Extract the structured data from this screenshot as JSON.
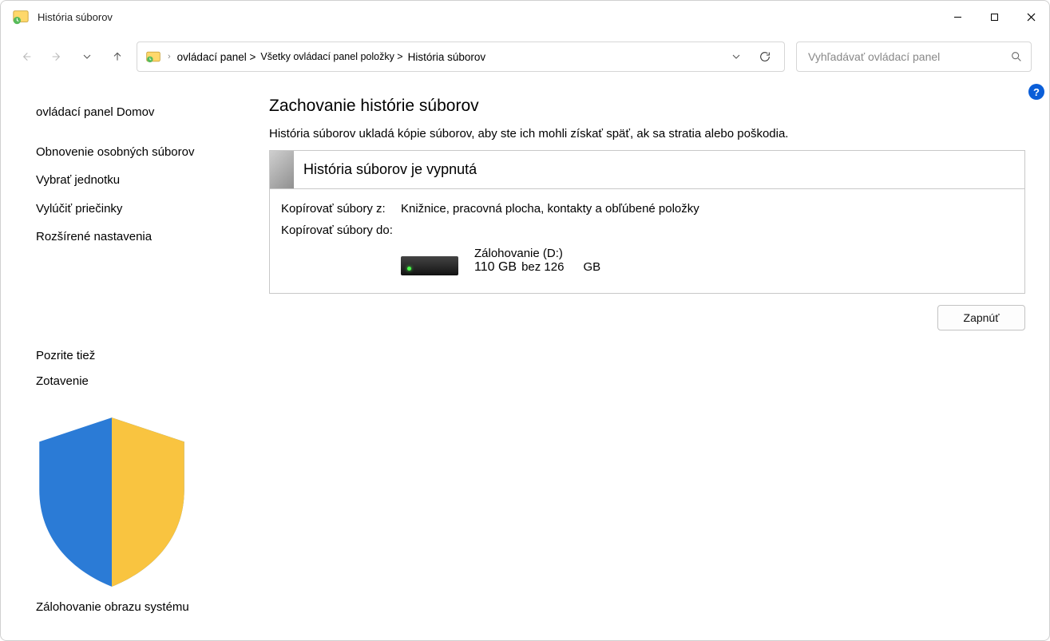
{
  "window": {
    "title": "História súborov"
  },
  "breadcrumb": {
    "segments": [
      "ovládací panel >",
      "Všetky ovládací panel položky >",
      "História súborov"
    ]
  },
  "search": {
    "placeholder": "Vyhľadávať ovládací panel"
  },
  "sidebar": {
    "home": "ovládací panel Domov",
    "links": [
      "Obnovenie osobných súborov",
      "Vybrať jednotku",
      "Vylúčiť priečinky",
      "Rozšírené nastavenia"
    ],
    "see_also_title": "Pozrite tiež",
    "see_also": [
      {
        "label": "Zotavenie",
        "shield": false
      },
      {
        "label": "Zálohovanie obrazu systému",
        "shield": true
      }
    ]
  },
  "main": {
    "title": "Zachovanie histórie súborov",
    "description": "História súborov ukladá kópie súborov, aby ste ich mohli získať späť, ak sa stratia alebo poškodia.",
    "status": "História súborov je vypnutá",
    "copy_from_label": "Kopírovať súbory z:",
    "copy_from_value": "Knižnice, pracovná plocha, kontakty a obľúbené položky",
    "copy_to_label": "Kopírovať súbory do:",
    "drive_name": "Zálohovanie (D:)",
    "drive_free": "110 GB",
    "drive_sep": "bez 126",
    "drive_total_unit": "GB",
    "turn_on_button": "Zapnúť"
  }
}
